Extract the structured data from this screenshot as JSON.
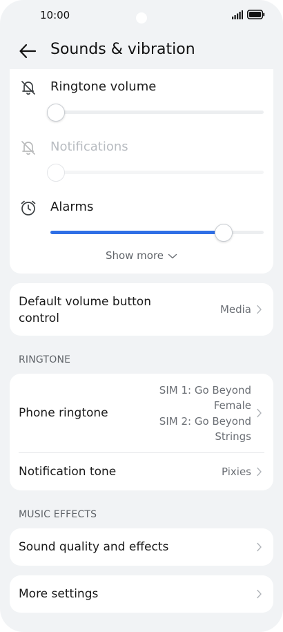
{
  "status_bar": {
    "time": "10:00"
  },
  "header": {
    "title": "Sounds & vibration"
  },
  "volumes": [
    {
      "label": "Ringtone volume",
      "level": 0.0,
      "enabled": true
    },
    {
      "label": "Notifications",
      "level": 0.0,
      "enabled": false
    },
    {
      "label": "Alarms",
      "level": 0.86,
      "enabled": true
    }
  ],
  "show_more": "Show more",
  "volume_button": {
    "title_line1": "Default volume button",
    "title_line2": "control",
    "value": "Media"
  },
  "ringtone_section": {
    "label": "RINGTONE",
    "phone_ringtone": {
      "title": "Phone ringtone",
      "value_lines": [
        "SIM 1: Go Beyond",
        "Female",
        "SIM 2: Go Beyond",
        "Strings"
      ]
    },
    "notification_tone": {
      "title": "Notification tone",
      "value": "Pixies"
    }
  },
  "music_section": {
    "label": "MUSIC EFFECTS",
    "sound_quality": {
      "title": "Sound quality and effects"
    }
  },
  "more_settings": {
    "title": "More settings"
  },
  "colors": {
    "accent": "#2f6fe6",
    "background": "#f1f3f5",
    "card": "#ffffff"
  }
}
